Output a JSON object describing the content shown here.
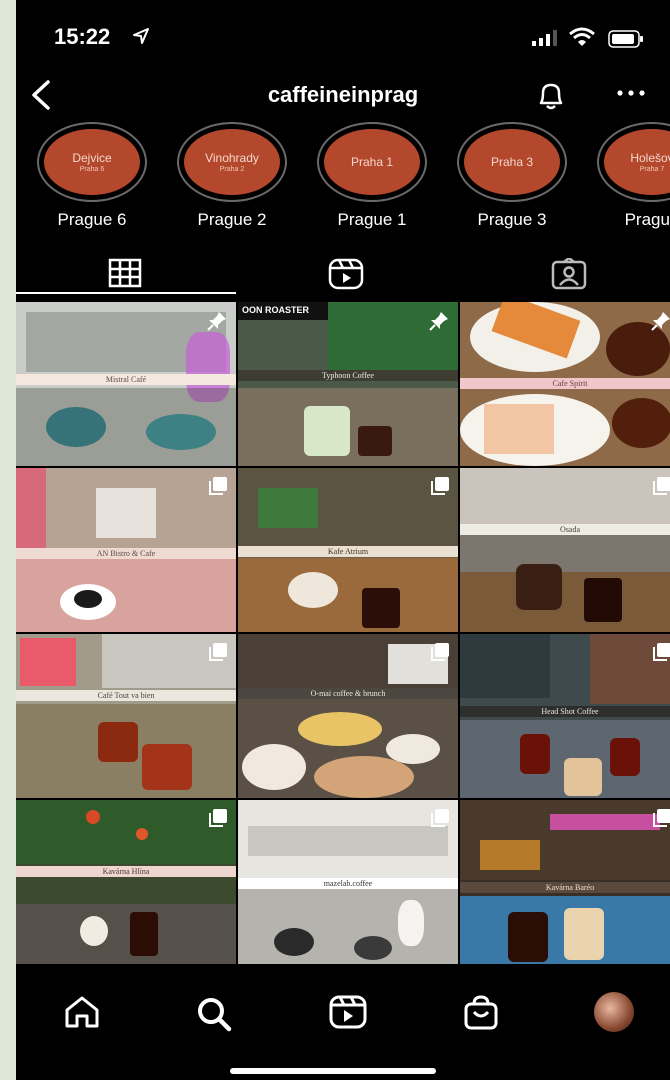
{
  "status": {
    "time": "15:22"
  },
  "header": {
    "title": "caffeineinprag"
  },
  "highlights": [
    {
      "main": "Dejvice",
      "sub": "Praha 6",
      "label": "Prague 6"
    },
    {
      "main": "Vinohrady",
      "sub": "Praha 2",
      "label": "Prague 2"
    },
    {
      "main": "Praha 1",
      "sub": "",
      "label": "Prague 1"
    },
    {
      "main": "Praha 3",
      "sub": "",
      "label": "Prague 3"
    },
    {
      "main": "Holešov",
      "sub": "Praha 7",
      "label": "Prague"
    }
  ],
  "tabs": [
    "grid-icon",
    "reels-icon",
    "tagged-icon"
  ],
  "posts": [
    {
      "caption": "Mistral Café",
      "badge": "pin-icon"
    },
    {
      "caption": "Typhoon Coffee",
      "badge": "pin-icon",
      "sign": "OON ROASTER"
    },
    {
      "caption": "Cafe Spirit",
      "badge": "pin-icon"
    },
    {
      "caption": "AN Bistro & Cafe",
      "badge": "carousel-icon"
    },
    {
      "caption": "Kafe Atrium",
      "badge": "carousel-icon"
    },
    {
      "caption": "Osada",
      "badge": "carousel-icon"
    },
    {
      "caption": "Café Tout va bien",
      "badge": "carousel-icon"
    },
    {
      "caption": "O-mai coffee & brunch",
      "badge": "carousel-icon"
    },
    {
      "caption": "Head Shot Coffee",
      "badge": "carousel-icon"
    },
    {
      "caption": "Kavárna Hlína",
      "badge": "carousel-icon"
    },
    {
      "caption": "mazelab.coffee",
      "badge": "carousel-icon"
    },
    {
      "caption": "Kavárna Baréo",
      "badge": "carousel-icon"
    }
  ],
  "nav": [
    "home-icon",
    "search-icon",
    "reels-icon",
    "shop-icon",
    "profile-avatar"
  ],
  "colors": {
    "highlight": "#b4482d",
    "background": "#000000",
    "text": "#ffffff"
  }
}
